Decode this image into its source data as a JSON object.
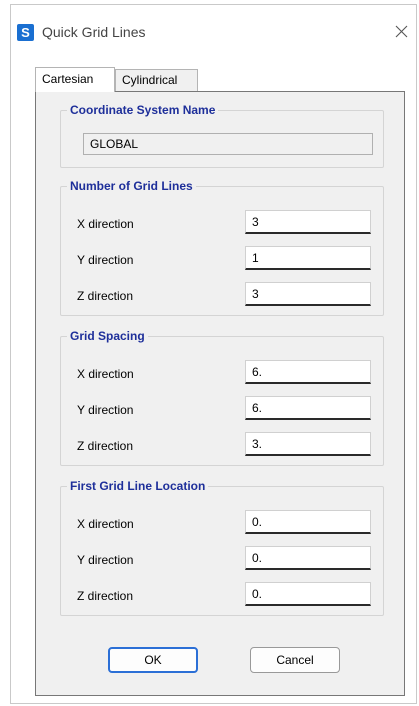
{
  "window": {
    "title": "Quick Grid Lines",
    "app_icon_letter": "S"
  },
  "tabs": [
    {
      "label": "Cartesian",
      "active": true
    },
    {
      "label": "Cylindrical",
      "active": false
    }
  ],
  "coordinate_system": {
    "title": "Coordinate System Name",
    "value": "GLOBAL"
  },
  "grid_lines": {
    "title": "Number of Grid Lines",
    "x_label": "X direction",
    "x_value": "3",
    "y_label": "Y direction",
    "y_value": "1",
    "z_label": "Z direction",
    "z_value": "3"
  },
  "grid_spacing": {
    "title": "Grid Spacing",
    "x_label": "X direction",
    "x_value": "6.",
    "y_label": "Y direction",
    "y_value": "6.",
    "z_label": "Z direction",
    "z_value": "3."
  },
  "first_location": {
    "title": "First Grid Line Location",
    "x_label": "X direction",
    "x_value": "0.",
    "y_label": "Y direction",
    "y_value": "0.",
    "z_label": "Z direction",
    "z_value": "0."
  },
  "buttons": {
    "ok": "OK",
    "cancel": "Cancel"
  },
  "colors": {
    "group_title": "#1e2f9a",
    "accent": "#2b6fd6",
    "app_icon": "#1a6fd1"
  }
}
